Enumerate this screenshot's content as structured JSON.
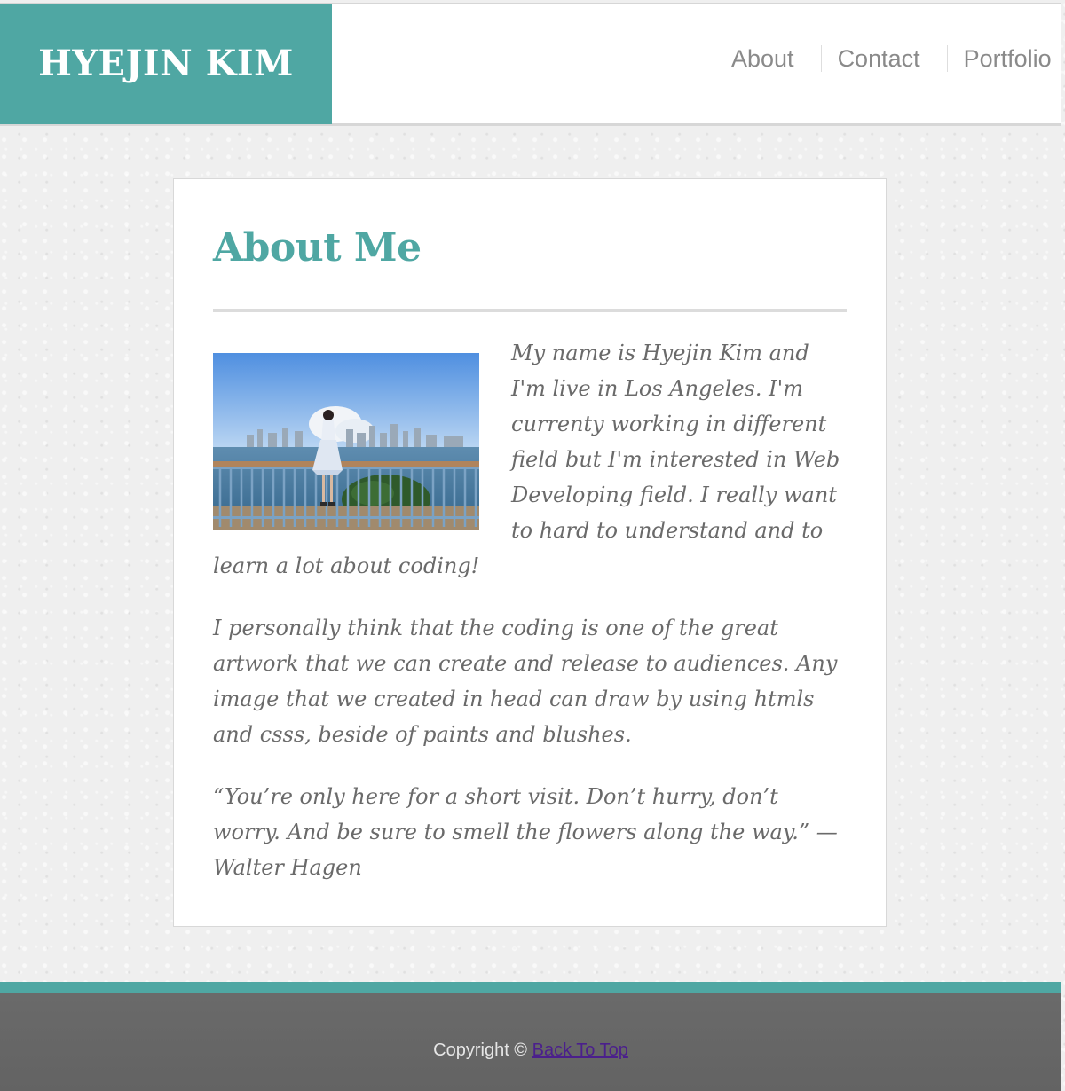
{
  "header": {
    "brand": "HYEJIN KIM",
    "nav": [
      {
        "label": "About"
      },
      {
        "label": "Contact"
      },
      {
        "label": "Portfolio"
      }
    ]
  },
  "main": {
    "title": "About Me",
    "paragraphs": [
      "My name is Hyejin Kim and I'm live in Los Angeles. I'm currenty working in different field but I'm interested in Web Developing field. I really want to hard to understand and to learn a lot about coding!",
      "I personally think that the coding is one of the great artwork that we can create and release to audiences. Any image that we created in head can draw by using htmls and csss, beside of paints and blushes.",
      "“You’re only here for a short visit. Don’t hurry, don’t worry. And be sure to smell the flowers along the way.” —Walter Hagen"
    ]
  },
  "footer": {
    "copyright": "Copyright ©",
    "back_to_top": "Back To Top"
  },
  "colors": {
    "accent": "#4fa7a3",
    "footer_bg": "#666666",
    "text": "#6a6a6a"
  }
}
